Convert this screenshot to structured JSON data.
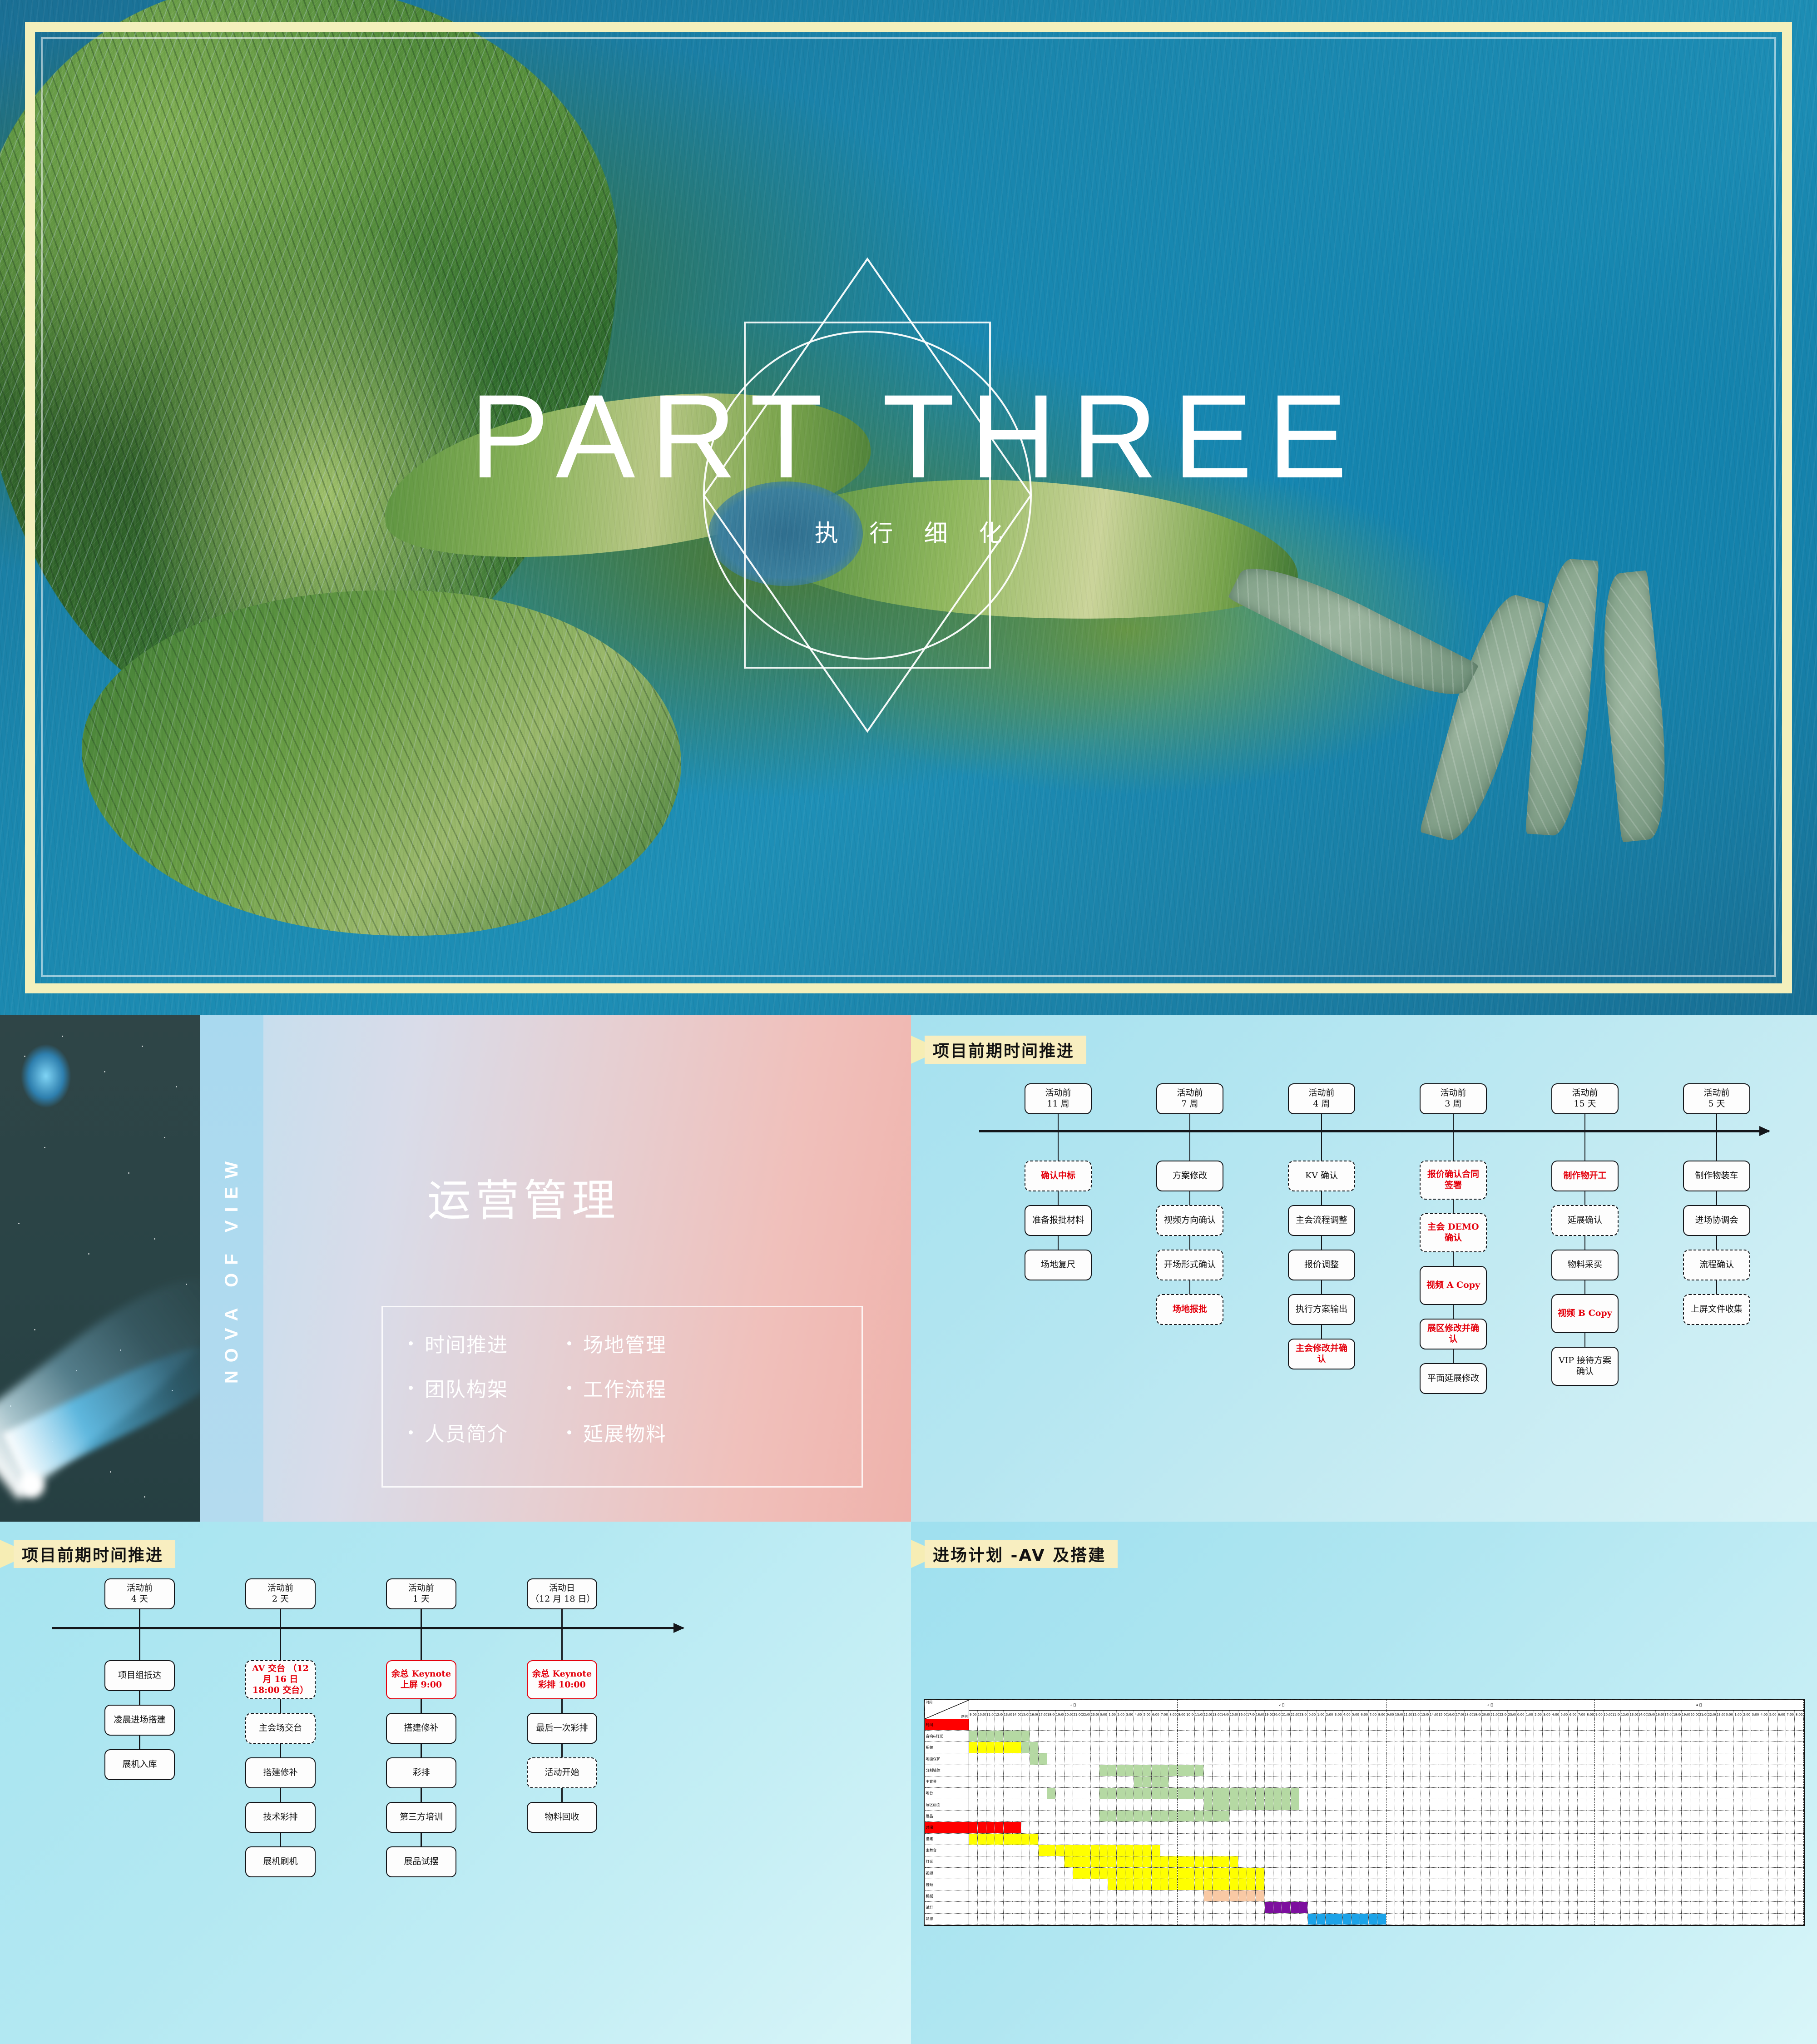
{
  "title_slide": {
    "main_title": "PART THREE",
    "sub_title": "执 行 细 化"
  },
  "ops_slide": {
    "vertical_label": "NOVA OF VIEW",
    "title": "运营管理",
    "columns": [
      {
        "items": [
          "时间推进",
          "团队构架",
          "人员简介"
        ]
      },
      {
        "items": [
          "场地管理",
          "工作流程",
          "延展物料"
        ]
      }
    ]
  },
  "flow1": {
    "heading": "项目前期时间推进",
    "columns": [
      {
        "marker": "活动前\n11 周",
        "nodes": [
          {
            "text": "确认中标",
            "style": "dashed-red"
          },
          {
            "text": "准备报批材料",
            "style": "solid"
          },
          {
            "text": "场地复尺",
            "style": "solid"
          }
        ]
      },
      {
        "marker": "活动前\n7 周",
        "nodes": [
          {
            "text": "方案修改",
            "style": "solid"
          },
          {
            "text": "视频方向确认",
            "style": "dashed"
          },
          {
            "text": "开场形式确认",
            "style": "dashed"
          },
          {
            "text": "场地报批",
            "style": "dashed-red"
          }
        ]
      },
      {
        "marker": "活动前\n4 周",
        "nodes": [
          {
            "text": "KV 确认",
            "style": "dashed"
          },
          {
            "text": "主会流程调整",
            "style": "solid"
          },
          {
            "text": "报价调整",
            "style": "solid"
          },
          {
            "text": "执行方案输出",
            "style": "solid"
          },
          {
            "text": "主会修改并确认",
            "style": "red"
          }
        ]
      },
      {
        "marker": "活动前\n3 周",
        "nodes": [
          {
            "text": "报价确认合同签署",
            "style": "dashed-red"
          },
          {
            "text": "主会 DEMO 确认",
            "style": "dashed-red"
          },
          {
            "text": "视频 A Copy",
            "style": "red"
          },
          {
            "text": "展区修改并确认",
            "style": "red"
          },
          {
            "text": "平面延展修改",
            "style": "solid"
          }
        ]
      },
      {
        "marker": "活动前\n15 天",
        "nodes": [
          {
            "text": "制作物开工",
            "style": "red"
          },
          {
            "text": "延展确认",
            "style": "dashed"
          },
          {
            "text": "物料采买",
            "style": "solid"
          },
          {
            "text": "视频 B Copy",
            "style": "red"
          },
          {
            "text": "VIP 接待方案确认",
            "style": "solid"
          }
        ]
      },
      {
        "marker": "活动前\n5 天",
        "nodes": [
          {
            "text": "制作物装车",
            "style": "solid"
          },
          {
            "text": "进场协调会",
            "style": "solid"
          },
          {
            "text": "流程确认",
            "style": "dashed"
          },
          {
            "text": "上屏文件收集",
            "style": "dashed"
          }
        ]
      }
    ]
  },
  "flow2": {
    "heading": "项目前期时间推进",
    "columns": [
      {
        "marker": "活动前\n4 天",
        "nodes": [
          {
            "text": "项目组抵达",
            "style": "solid"
          },
          {
            "text": "凌晨进场搭建",
            "style": "solid"
          },
          {
            "text": "展机入库",
            "style": "solid"
          }
        ]
      },
      {
        "marker": "活动前\n2 天",
        "nodes": [
          {
            "text": "AV 交台\n（12 月 16 日 18:00 交台）",
            "style": "dashed-red"
          },
          {
            "text": "主会场交台",
            "style": "dashed"
          },
          {
            "text": "搭建修补",
            "style": "solid"
          },
          {
            "text": "技术彩排",
            "style": "solid"
          },
          {
            "text": "展机刷机",
            "style": "solid"
          }
        ]
      },
      {
        "marker": "活动前\n1 天",
        "nodes": [
          {
            "text": "余总 Keynote 上屏 9:00",
            "style": "redbox"
          },
          {
            "text": "搭建修补",
            "style": "solid"
          },
          {
            "text": "彩排",
            "style": "solid"
          },
          {
            "text": "第三方培训",
            "style": "solid"
          },
          {
            "text": "展品试摆",
            "style": "solid"
          }
        ]
      },
      {
        "marker": "活动日\n（12 月 18 日）",
        "nodes": [
          {
            "text": "余总 Keynote 彩排 10:00",
            "style": "redbox"
          },
          {
            "text": "最后一次彩排",
            "style": "solid"
          },
          {
            "text": "活动开始",
            "style": "dashed"
          },
          {
            "text": "物料回收",
            "style": "solid"
          }
        ]
      }
    ]
  },
  "gantt": {
    "heading": "进场计划 -AV 及搭建",
    "corner_top": "时间",
    "corner_bottom": "序列",
    "days": [
      "1 日",
      "2 日",
      "3 日",
      "4 日"
    ],
    "hours": [
      "9:00",
      "10:00",
      "11:00",
      "12:00",
      "13:00",
      "14:00",
      "15:00",
      "16:00",
      "17:00",
      "18:00",
      "19:00",
      "20:00",
      "21:00",
      "22:00",
      "23:00",
      "0:00",
      "1:00",
      "2:00",
      "3:00",
      "4:00",
      "5:00",
      "6:00",
      "7:00",
      "8:00"
    ],
    "colors": {
      "green": "#b5d9a3",
      "yellow": "#ffff00",
      "red": "#ff0000",
      "peach": "#f9c9a4",
      "purple": "#7d0f9e",
      "blue": "#1ca3e8"
    },
    "rows": [
      {
        "label": "时间",
        "header": true,
        "color": "red",
        "bars": []
      },
      {
        "label": "音响&灯光",
        "color": "green",
        "bars": [
          [
            0,
            7
          ]
        ]
      },
      {
        "label": "桁架",
        "color": "yellow",
        "bars": [
          [
            0,
            6
          ]
        ],
        "bars2": {
          "color": "green",
          "spans": [
            [
              6,
              2
            ]
          ]
        }
      },
      {
        "label": "地面保护",
        "color": "green",
        "bars": [
          [
            7,
            2
          ]
        ]
      },
      {
        "label": "分割墙体",
        "color": "green",
        "bars": [
          [
            15,
            12
          ]
        ]
      },
      {
        "label": "主背景",
        "color": "green",
        "bars": [
          [
            19,
            4
          ]
        ]
      },
      {
        "label": "地台",
        "color": "green",
        "bars": [
          [
            9,
            1
          ],
          [
            15,
            23
          ]
        ]
      },
      {
        "label": "展区画面",
        "color": "green",
        "bars": [
          [
            27,
            11
          ]
        ]
      },
      {
        "label": "展品",
        "color": "green",
        "bars": [
          [
            15,
            15
          ]
        ]
      },
      {
        "label": "时间",
        "header": true,
        "color": "red",
        "bars": [
          [
            0,
            6
          ]
        ]
      },
      {
        "label": "搭建",
        "color": "yellow",
        "bars": [
          [
            0,
            8
          ]
        ]
      },
      {
        "label": "主舞台",
        "color": "yellow",
        "bars": [
          [
            8,
            14
          ]
        ]
      },
      {
        "label": "灯光",
        "color": "yellow",
        "bars": [
          [
            11,
            20
          ]
        ]
      },
      {
        "label": "视频",
        "color": "yellow",
        "bars": [
          [
            12,
            22
          ]
        ]
      },
      {
        "label": "音频",
        "color": "yellow",
        "bars": [
          [
            16,
            18
          ]
        ]
      },
      {
        "label": "机械",
        "color": "peach",
        "bars": [
          [
            27,
            7
          ]
        ]
      },
      {
        "label": "试灯",
        "color": "purple",
        "bars": [
          [
            34,
            5
          ]
        ]
      },
      {
        "label": "彩排",
        "color": "blue",
        "bars": [
          [
            39,
            9
          ]
        ]
      }
    ]
  }
}
